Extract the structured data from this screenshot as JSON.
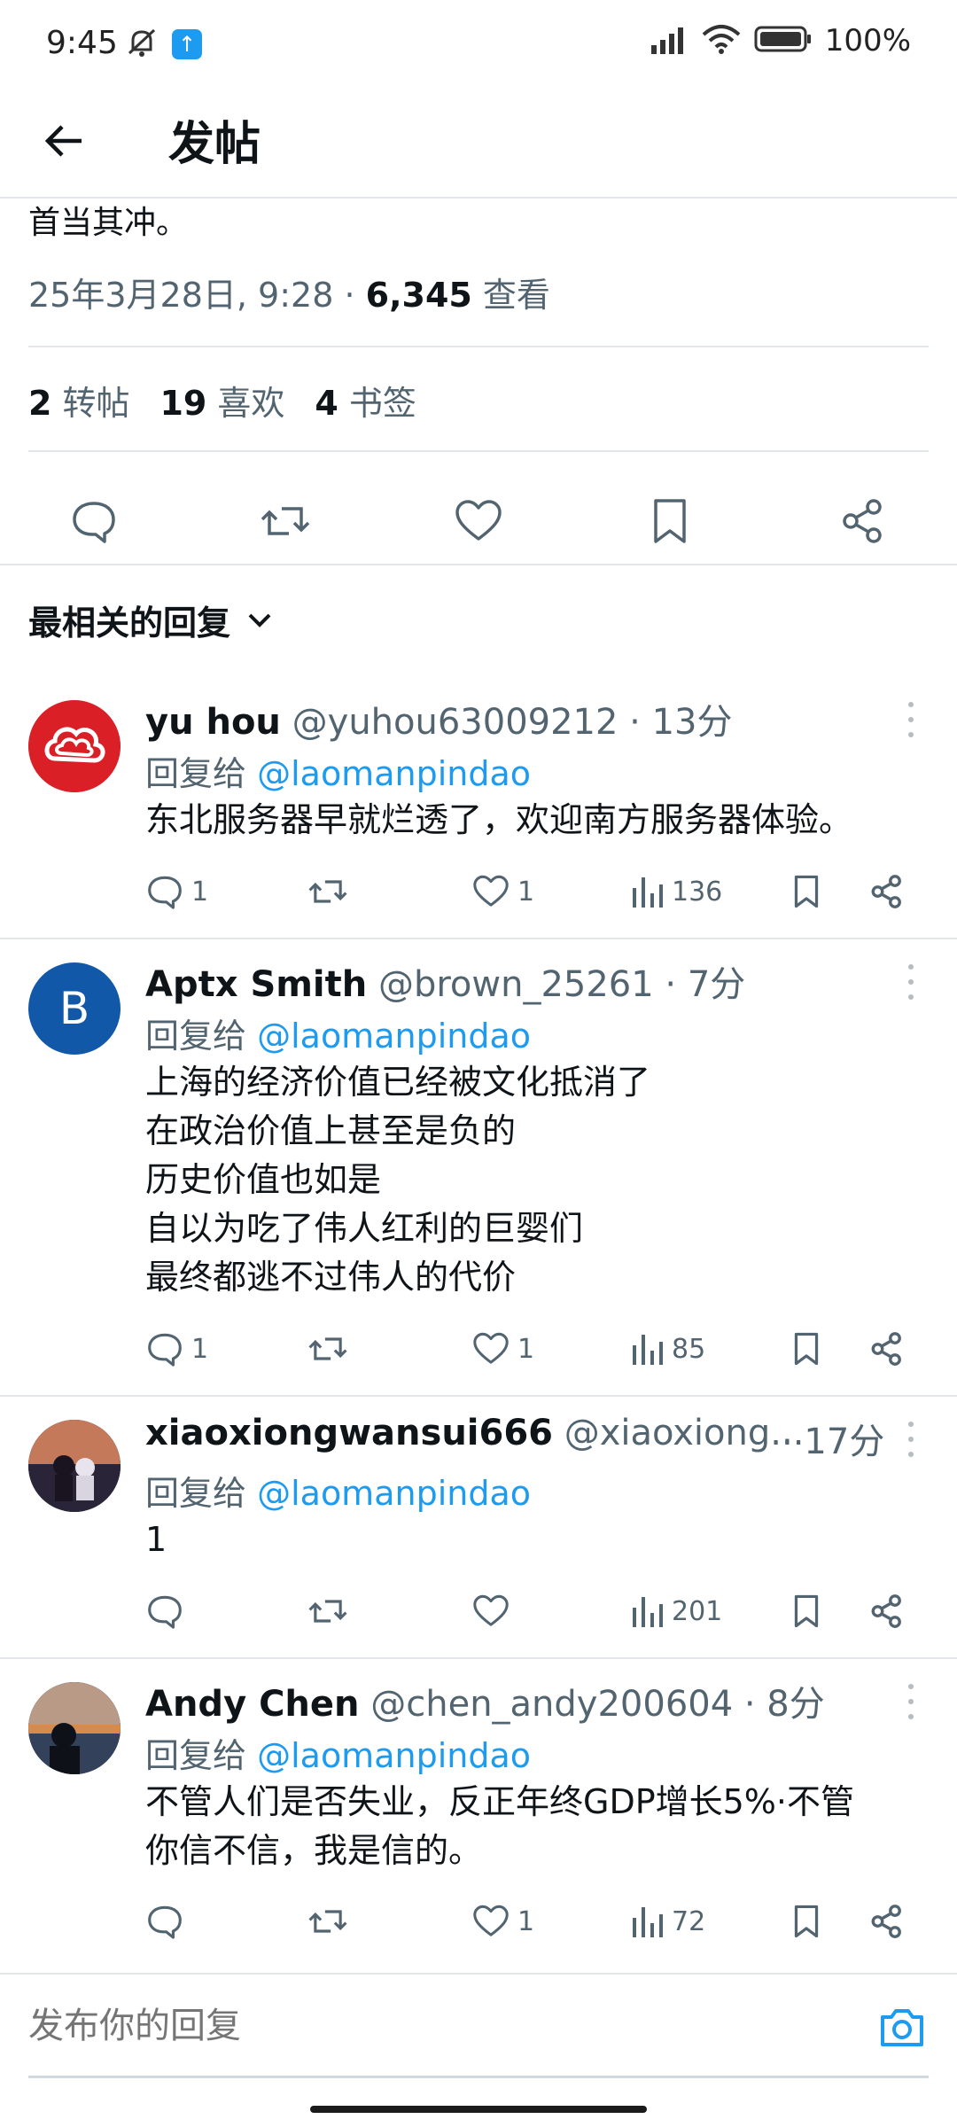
{
  "status_bar": {
    "time": "9:45",
    "battery": "100%",
    "icons": [
      "mute-icon",
      "upload-badge-icon",
      "signal-icon",
      "wifi-icon",
      "battery-icon"
    ]
  },
  "header": {
    "title": "发帖"
  },
  "post": {
    "text_tail": "首当其冲。",
    "timestamp": "25年3月28日, 9:28 · ",
    "views_count": "6,345",
    "views_label": " 查看",
    "stats": {
      "reposts_count": "2",
      "reposts_label": "转帖",
      "likes_count": "19",
      "likes_label": "喜欢",
      "bookmarks_count": "4",
      "bookmarks_label": "书签"
    }
  },
  "sort": {
    "label": "最相关的回复"
  },
  "replies": [
    {
      "name": "yu hou",
      "handle": "@yuhou63009212 · 13分",
      "reply_to_label": "回复给 ",
      "reply_to_handle": "@laomanpindao",
      "text": "东北服务器早就烂透了，欢迎南方服务器体验。",
      "comments": "1",
      "reposts": "",
      "likes": "1",
      "views": "136"
    },
    {
      "name": "Aptx Smith",
      "handle": "@brown_25261 · 7分",
      "avatar_letter": "B",
      "reply_to_label": "回复给 ",
      "reply_to_handle": "@laomanpindao",
      "text": "上海的经济价值已经被文化抵消了\n在政治价值上甚至是负的\n历史价值也如是\n自以为吃了伟人红利的巨婴们\n最终都逃不过伟人的代价",
      "comments": "1",
      "reposts": "",
      "likes": "1",
      "views": "85"
    },
    {
      "name": "xiaoxiongwansui666",
      "handle": "@xiaoxiong...",
      "time": "· 17分",
      "reply_to_label": "回复给 ",
      "reply_to_handle": "@laomanpindao",
      "text": "1",
      "comments": "",
      "reposts": "",
      "likes": "",
      "views": "201"
    },
    {
      "name": "Andy Chen",
      "handle": "@chen_andy200604 · 8分",
      "reply_to_label": "回复给 ",
      "reply_to_handle": "@laomanpindao",
      "text": "不管人们是否失业，反正年终GDP增长5%·不管\n你信不信，我是信的。",
      "comments": "",
      "reposts": "",
      "likes": "1",
      "views": "72"
    }
  ],
  "composer": {
    "placeholder": "发布你的回复"
  },
  "colors": {
    "accent": "#1d9bf0",
    "text_primary": "#0f1419",
    "text_secondary": "#536471",
    "divider": "#e1e6ea"
  }
}
